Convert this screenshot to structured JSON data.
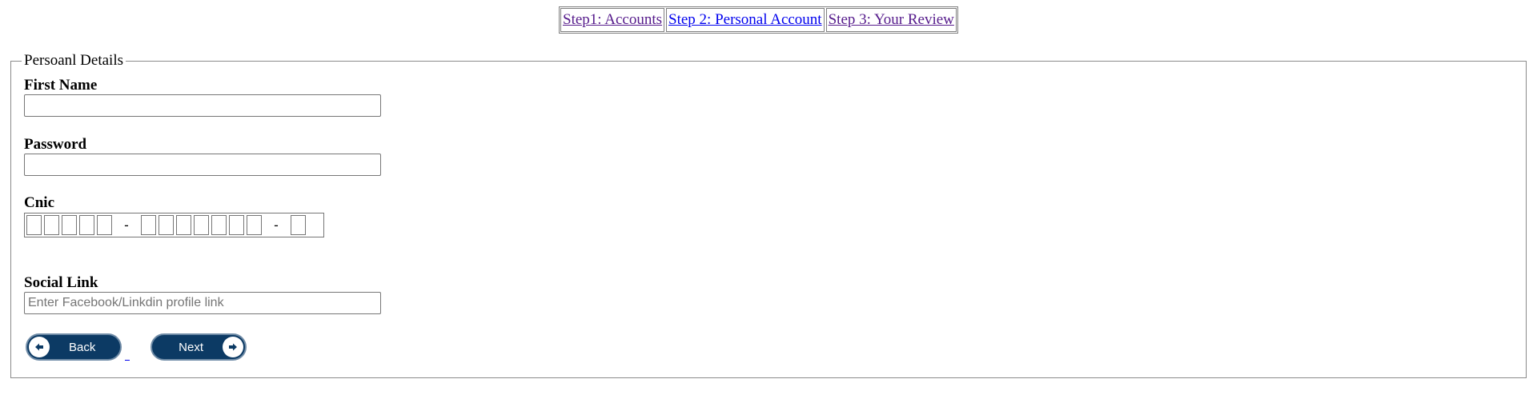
{
  "steps": [
    {
      "label": "Step1: Accounts",
      "state": "visited"
    },
    {
      "label": "Step 2: Personal Account",
      "state": "active"
    },
    {
      "label": "Step 3: Your Review",
      "state": "visited"
    }
  ],
  "fieldset": {
    "legend": "Persoanl Details"
  },
  "form": {
    "first_name": {
      "label": "First Name",
      "value": "",
      "placeholder": ""
    },
    "password": {
      "label": "Password",
      "value": "",
      "placeholder": ""
    },
    "cnic": {
      "label": "Cnic",
      "separator": "-",
      "groups": [
        5,
        7,
        1
      ]
    },
    "social_link": {
      "label": "Social Link",
      "value": "",
      "placeholder": "Enter Facebook/Linkdin profile link"
    }
  },
  "buttons": {
    "back_label": "Back",
    "next_label": "Next"
  },
  "colors": {
    "button_bg": "#0c3a64",
    "link_visited": "#551a8b",
    "link_active": "#0000ee"
  },
  "icons": {
    "back": "arrow-left-circle-icon",
    "next": "arrow-right-circle-icon"
  }
}
